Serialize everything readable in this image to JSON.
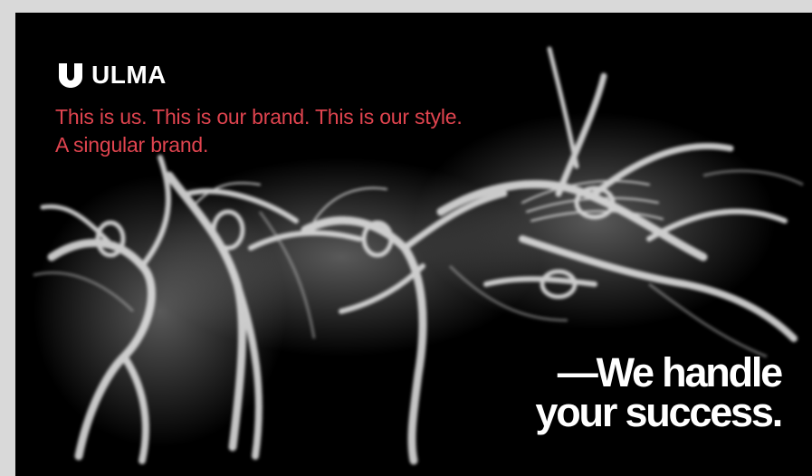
{
  "brand": {
    "name": "ULMA"
  },
  "tagline": {
    "line1": "This is us. This is our brand. This is our style.",
    "line2": "A singular brand."
  },
  "claim": {
    "line1": "—We handle",
    "line2": "your success."
  },
  "colors": {
    "background": "#000000",
    "accent": "#e0444f",
    "text": "#ffffff",
    "page": "#d9d9d9"
  },
  "icons": {
    "logo": "ulma-u-mark-icon"
  }
}
